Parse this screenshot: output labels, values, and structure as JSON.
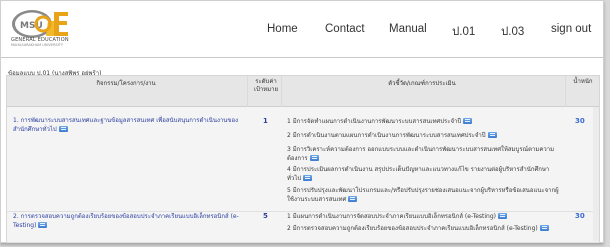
{
  "header": {
    "logo_mark": "MSU GE",
    "logo_text": "GENERAL EDUCATION",
    "logo_subtext": "MAHASARAKHAM UNIVERSITY",
    "nav": [
      "Home",
      "Contact",
      "Manual",
      "ป.01",
      "ป.03",
      "sign out"
    ]
  },
  "page": {
    "caption": "ข้อมูลแบบ ป.01 (นางสุพิพร อยู่พร้า)"
  },
  "table": {
    "headers": {
      "task": "กิจกรรม/โครงการ/งาน",
      "level": "ระดับค่าเป้าหมาย",
      "indicators": "ตัวชี้วัด/เกณฑ์การประเมิน",
      "weight": "น้ำหนัก"
    },
    "rows": [
      {
        "task": "1. การพัฒนาระบบสารสนเทศและฐานข้อมูลสารสนเทศ เพื่อสนับสนุนการดำเนินงานของสำนักศึกษาทั่วไป",
        "level": "1",
        "indicators": [
          "1 มีการจัดทำแผนการดำเนินงานการพัฒนาระบบสารสนเทศประจำปี",
          "2 มีการดำเนินงานตามแผนการดำเนินงานการพัฒนาระบบสารสนเทศประจำปี",
          "3 มีการวิเคราะห์ความต้องการ ออกแบบระบบและดำเนินการพัฒนาระบบสารสนเทศให้สมบูรณ์ตามความต้องการ",
          "4 มีการประเมินผลการดำเนินงาน สรุปประเด็นปัญหาและแนวทางแก้ไข รายงานต่อผู้บริหารสำนักศึกษาทั่วไป",
          "5 มีการปรับปรุงและพัฒนาโปรแกรมและ/หรือปรับปรุงรายช่องเสนอแนะจากผู้บริหารหรือข้อเสนอแนะจากผู้ใช้งานระบบสารสนเทศ"
        ],
        "weight": "30"
      },
      {
        "task": "2. การตรวจสอบความถูกต้องเรียบร้อยของข้อสอบประจำภาคเรียนแบบอิเล็กทรอนิกส์ (e-Testing)",
        "level": "5",
        "indicators": [
          "1 มีแผนการดำเนินงานการจัดสอบประจำภาคเรียนแบบอิเล็กทรอนิกส์ (e-Testing)",
          "2 มีการตรวจสอบความถูกต้องเรียบร้อยของข้อสอบประจำภาคเรียนแบบอิเล็กทรอนิกส์ (e-Testing)"
        ],
        "weight": "30"
      }
    ]
  }
}
